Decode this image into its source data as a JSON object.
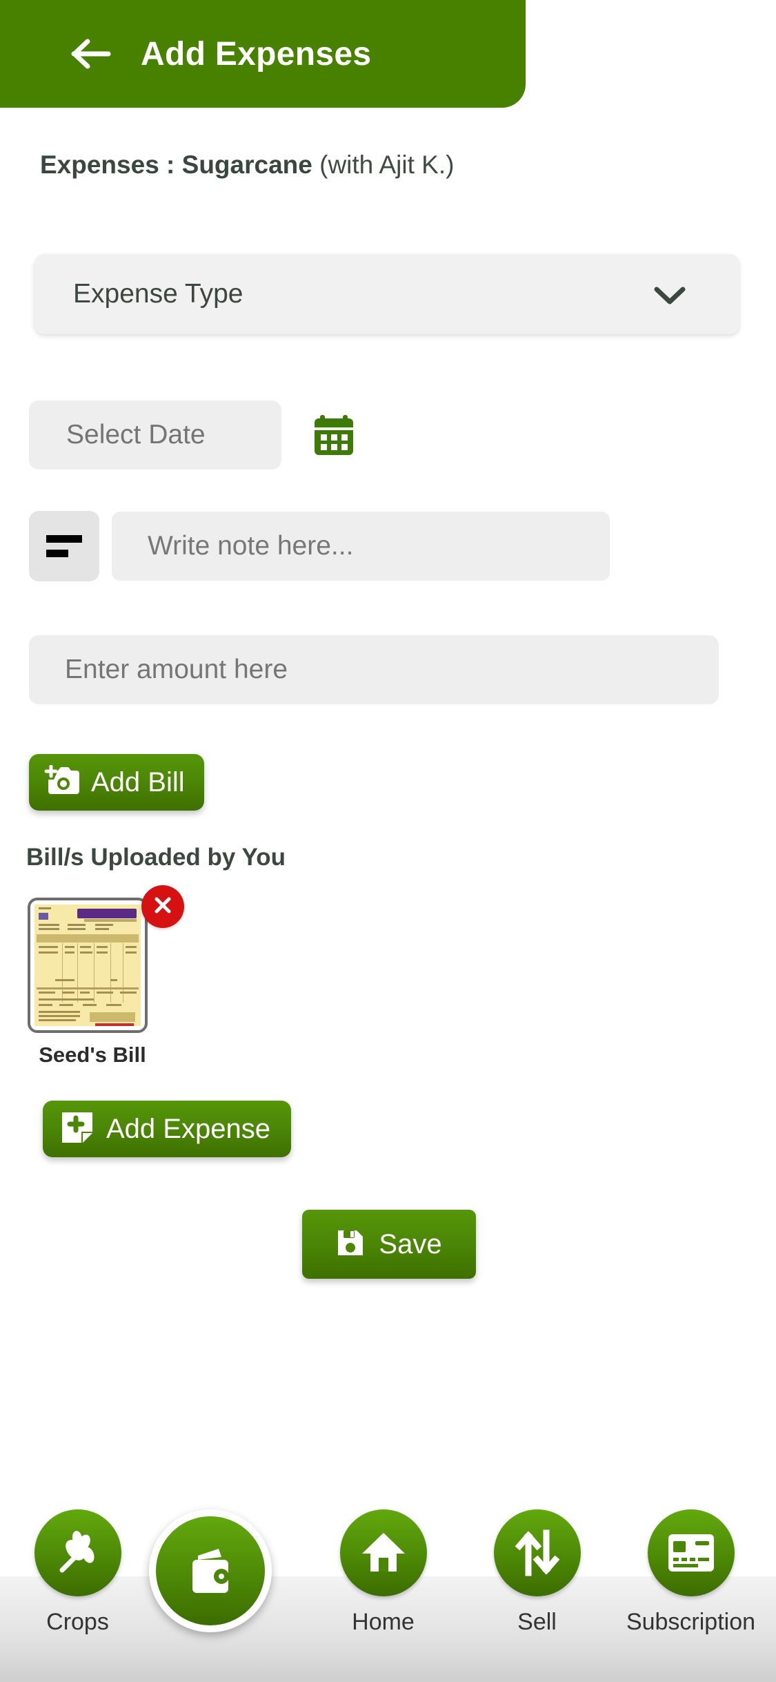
{
  "header": {
    "back_icon": "arrow-left-icon",
    "title": "Add Expenses"
  },
  "subtitle": {
    "bold_part": "Expenses : Sugarcane",
    "normal_part": " (with Ajit K.)"
  },
  "form": {
    "expense_type": {
      "label": "Expense Type",
      "chevron_icon": "chevron-down-icon"
    },
    "date": {
      "placeholder": "Select Date",
      "value": "",
      "calendar_icon": "calendar-icon"
    },
    "note": {
      "icon": "note-lines-icon",
      "placeholder": "Write note here...",
      "value": ""
    },
    "amount": {
      "placeholder": "Enter amount here",
      "value": ""
    }
  },
  "actions": {
    "add_bill": {
      "label": "Add Bill",
      "icon": "camera-plus-icon"
    },
    "add_expense": {
      "label": "Add Expense",
      "icon": "note-plus-icon"
    },
    "save": {
      "label": "Save",
      "icon": "floppy-disk-icon"
    }
  },
  "bills": {
    "section_title": "Bill/s Uploaded by You",
    "items": [
      {
        "label": "Seed's Bill",
        "delete_icon": "close-icon"
      }
    ]
  },
  "bottom_nav": {
    "items": [
      {
        "label": "Crops",
        "icon": "plant-leaf-icon",
        "active": false
      },
      {
        "label": "",
        "icon": "wallet-icon",
        "active": true
      },
      {
        "label": "Home",
        "icon": "home-icon",
        "active": false
      },
      {
        "label": "Sell",
        "icon": "sell-arrows-icon",
        "active": false
      },
      {
        "label": "Subscription",
        "icon": "card-icon",
        "active": false
      }
    ]
  },
  "colors": {
    "brand_green": "#488000",
    "button_green": "#4c8606",
    "field_gray": "#eeeeee",
    "delete_red": "#d61111",
    "text_dark": "#3b4740"
  }
}
